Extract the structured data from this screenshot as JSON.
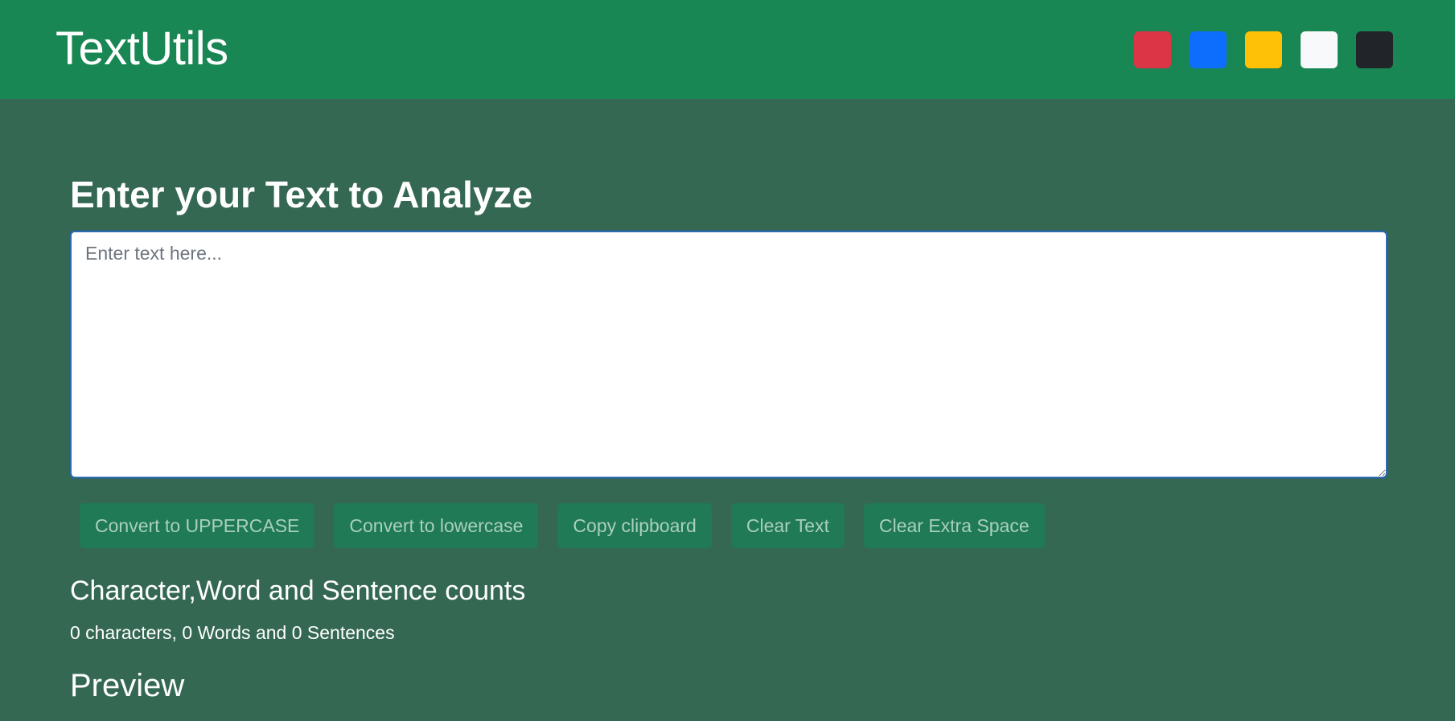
{
  "navbar": {
    "brand": "TextUtils",
    "theme_swatches": [
      {
        "name": "red",
        "color": "#dc3545"
      },
      {
        "name": "blue",
        "color": "#0d6efd"
      },
      {
        "name": "yellow",
        "color": "#ffc107"
      },
      {
        "name": "light",
        "color": "#f8f9fa"
      },
      {
        "name": "dark",
        "color": "#212529"
      }
    ]
  },
  "main": {
    "heading": "Enter your Text to Analyze",
    "textarea": {
      "value": "",
      "placeholder": "Enter text here..."
    },
    "buttons": {
      "uppercase": "Convert to UPPERCASE",
      "lowercase": "Convert to lowercase",
      "copy": "Copy clipboard",
      "clear": "Clear Text",
      "clear_space": "Clear Extra Space"
    },
    "summary": {
      "heading": "Character,Word and Sentence counts",
      "text": "0 characters, 0 Words and 0 Sentences"
    },
    "preview": {
      "heading": "Preview"
    }
  },
  "colors": {
    "navbar_bg": "#198754",
    "page_bg": "#346852",
    "button_bg": "#1f7a55",
    "button_text": "#a9cfbd"
  }
}
